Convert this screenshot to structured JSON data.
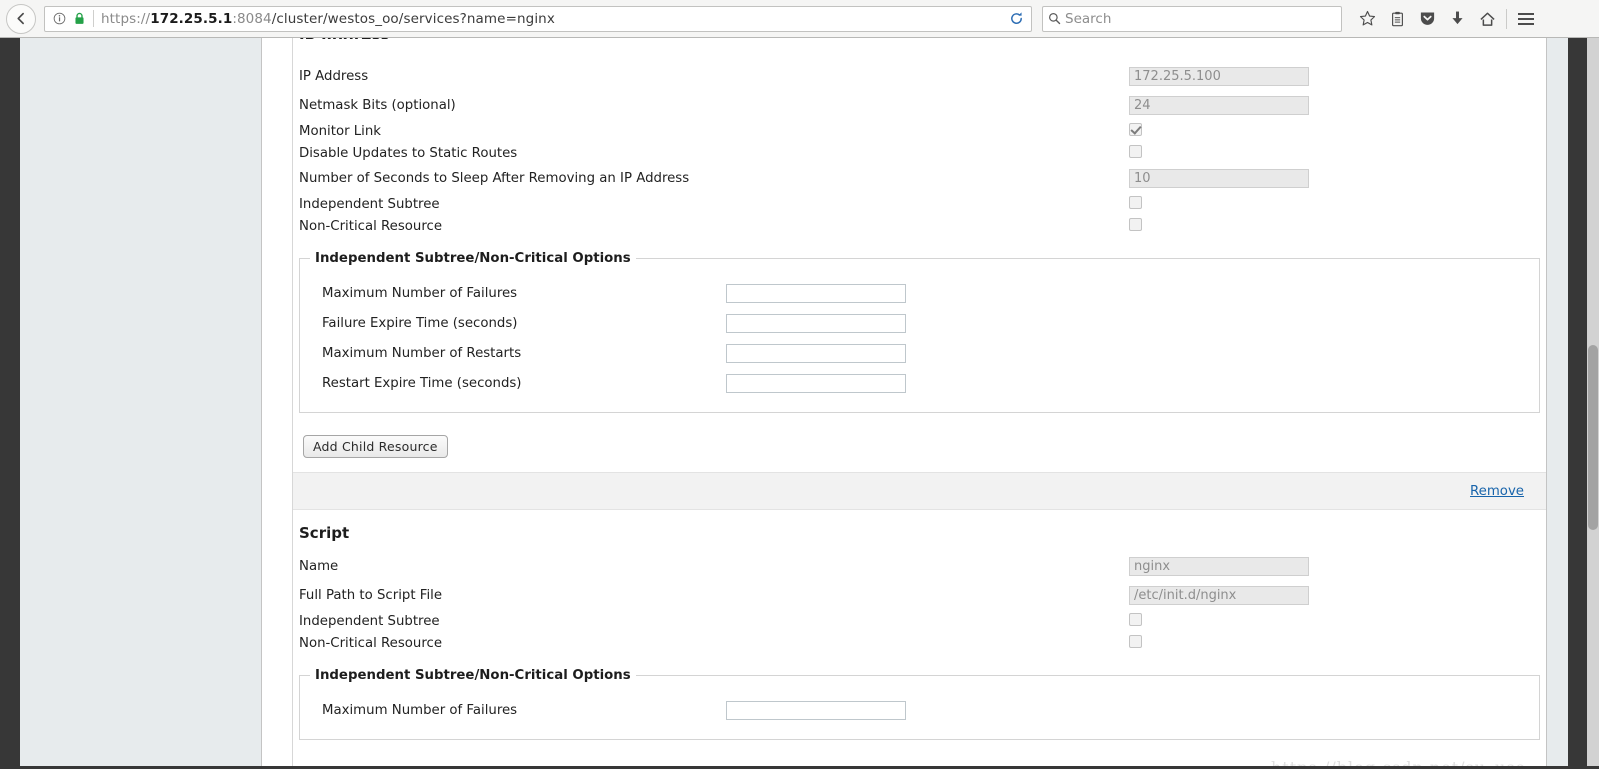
{
  "browser": {
    "back_label": "❮",
    "identity_icon": "info-icon",
    "lock_icon": "padlock-icon",
    "url_scheme": "https://",
    "url_host": "172.25.5.1",
    "url_port": ":8084",
    "url_path": "/cluster/westos_oo/services?name=nginx",
    "url_full": "https://172.25.5.1:8084/cluster/westos_oo/services?name=nginx",
    "reload_label": "⟳",
    "search_placeholder": "Search",
    "toolbar_icons": [
      "bookmark-star-icon",
      "library-icon",
      "pocket-shield-icon",
      "downloads-arrow-icon",
      "home-icon",
      "hamburger-menu-icon"
    ]
  },
  "resources": [
    {
      "id": "ip-address",
      "heading": "IP Address",
      "heading_clipped": true,
      "fields": [
        {
          "label": "IP Address",
          "type": "text",
          "value": "172.25.5.100",
          "disabled": true
        },
        {
          "label": "Netmask Bits (optional)",
          "type": "text",
          "value": "24",
          "disabled": true
        },
        {
          "label": "Monitor Link",
          "type": "checkbox",
          "checked": true,
          "disabled": true
        },
        {
          "label": "Disable Updates to Static Routes",
          "type": "checkbox",
          "checked": false,
          "disabled": true
        },
        {
          "label": "Number of Seconds to Sleep After Removing an IP Address",
          "type": "text",
          "value": "10",
          "disabled": true
        },
        {
          "label": "Independent Subtree",
          "type": "checkbox",
          "checked": false,
          "disabled": false
        },
        {
          "label": "Non-Critical Resource",
          "type": "checkbox",
          "checked": false,
          "disabled": false
        }
      ],
      "options": {
        "legend": "Independent Subtree/Non-Critical Options",
        "rows": [
          {
            "label": "Maximum Number of Failures",
            "value": ""
          },
          {
            "label": "Failure Expire Time (seconds)",
            "value": ""
          },
          {
            "label": "Maximum Number of Restarts",
            "value": ""
          },
          {
            "label": "Restart Expire Time (seconds)",
            "value": ""
          }
        ]
      },
      "add_child_label": "Add Child Resource",
      "remove_label": "Remove"
    },
    {
      "id": "script",
      "heading": "Script",
      "heading_clipped": false,
      "fields": [
        {
          "label": "Name",
          "type": "text",
          "value": "nginx",
          "disabled": true
        },
        {
          "label": "Full Path to Script File",
          "type": "text",
          "value": "/etc/init.d/nginx",
          "disabled": true
        },
        {
          "label": "Independent Subtree",
          "type": "checkbox",
          "checked": false,
          "disabled": false
        },
        {
          "label": "Non-Critical Resource",
          "type": "checkbox",
          "checked": false,
          "disabled": false
        }
      ],
      "options": {
        "legend": "Independent Subtree/Non-Critical Options",
        "rows": [
          {
            "label": "Maximum Number of Failures",
            "value": ""
          }
        ]
      }
    }
  ],
  "watermark": "https://blog.csdn.net/su_use",
  "colors": {
    "link": "#1864ab",
    "chrome_bg": "#f5f5f4",
    "disabled_input_bg": "#e9e9e9",
    "gutter": "#e7ebed",
    "dark_strip": "#373737"
  }
}
